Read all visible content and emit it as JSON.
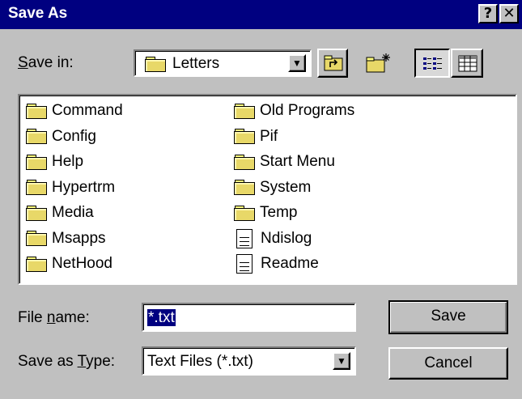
{
  "window": {
    "title": "Save As",
    "help_button": "?",
    "close_button": "✕"
  },
  "toolbar": {
    "save_in_label_prefix": "",
    "save_in_label_mnemonic": "S",
    "save_in_label_rest": "ave in:",
    "save_in_value": "Letters"
  },
  "files": {
    "col1": [
      "Command",
      "Config",
      "Help",
      "Hypertrm",
      "Media",
      "Msapps",
      "NetHood"
    ],
    "col2": [
      {
        "name": "Old Programs",
        "type": "folder"
      },
      {
        "name": "Pif",
        "type": "folder"
      },
      {
        "name": "Start Menu",
        "type": "folder"
      },
      {
        "name": "System",
        "type": "folder"
      },
      {
        "name": "Temp",
        "type": "folder"
      },
      {
        "name": "Ndislog",
        "type": "document"
      },
      {
        "name": "Readme",
        "type": "document"
      }
    ]
  },
  "form": {
    "filename_label_prefix": "File ",
    "filename_label_mnemonic": "n",
    "filename_label_rest": "ame:",
    "filename_value": "*.txt",
    "savetype_label_prefix": "Save as ",
    "savetype_label_mnemonic": "T",
    "savetype_label_rest": "ype:",
    "savetype_value": "Text Files (*.txt)",
    "save_button": "Save",
    "cancel_button": "Cancel"
  }
}
